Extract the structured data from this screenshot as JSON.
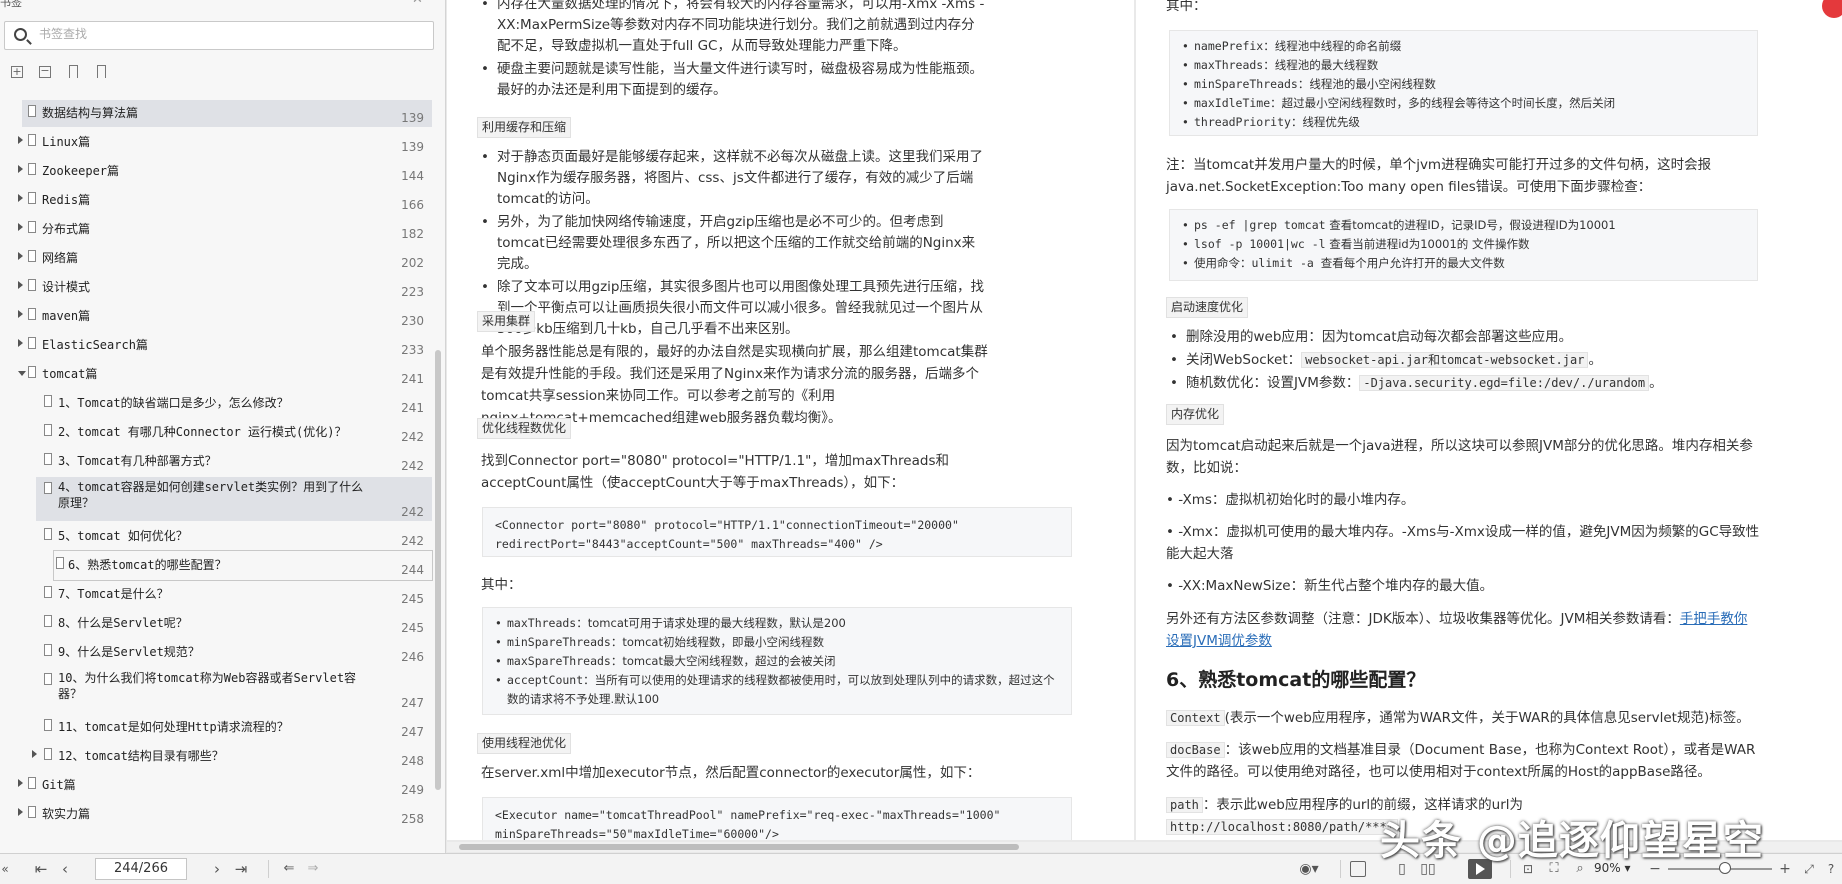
{
  "sidebar": {
    "header_label": "书签",
    "search_placeholder": "书签查找",
    "toc": [
      {
        "title": "数据结构与算法篇",
        "page": "139",
        "level": 0,
        "expander": "none",
        "highlight": true
      },
      {
        "title": "Linux篇",
        "page": "139",
        "level": 0,
        "expander": "collapsed"
      },
      {
        "title": "Zookeeper篇",
        "page": "144",
        "level": 0,
        "expander": "collapsed"
      },
      {
        "title": "Redis篇",
        "page": "166",
        "level": 0,
        "expander": "collapsed"
      },
      {
        "title": "分布式篇",
        "page": "182",
        "level": 0,
        "expander": "collapsed"
      },
      {
        "title": "网络篇",
        "page": "202",
        "level": 0,
        "expander": "collapsed"
      },
      {
        "title": "设计模式",
        "page": "223",
        "level": 0,
        "expander": "collapsed"
      },
      {
        "title": "maven篇",
        "page": "230",
        "level": 0,
        "expander": "collapsed"
      },
      {
        "title": "ElasticSearch篇",
        "page": "233",
        "level": 0,
        "expander": "collapsed"
      },
      {
        "title": "tomcat篇",
        "page": "241",
        "level": 0,
        "expander": "expanded"
      },
      {
        "title": "1、Tomcat的缺省端口是多少，怎么修改？",
        "page": "241",
        "level": 1,
        "expander": "none"
      },
      {
        "title": "2、tomcat 有哪几种Connector 运行模式(优化)？",
        "page": "242",
        "level": 1,
        "expander": "none"
      },
      {
        "title": "3、Tomcat有几种部署方式？",
        "page": "242",
        "level": 1,
        "expander": "none"
      },
      {
        "title": "4、tomcat容器是如何创建servlet类实例？用到了什么原理？",
        "page": "242",
        "level": 1,
        "expander": "none",
        "highlight": true,
        "tall": true
      },
      {
        "title": "5、tomcat 如何优化？",
        "page": "242",
        "level": 1,
        "expander": "none"
      },
      {
        "title": "6、熟悉tomcat的哪些配置？",
        "page": "244",
        "level": 1,
        "expander": "none",
        "current": true
      },
      {
        "title": "7、Tomcat是什么？",
        "page": "245",
        "level": 1,
        "expander": "none"
      },
      {
        "title": "8、什么是Servlet呢？",
        "page": "245",
        "level": 1,
        "expander": "none"
      },
      {
        "title": "9、什么是Servlet规范？",
        "page": "246",
        "level": 1,
        "expander": "none"
      },
      {
        "title": "10、为什么我们将tomcat称为Web容器或者Servlet容器？",
        "page": "247",
        "level": 1,
        "expander": "none",
        "tall": true
      },
      {
        "title": "11、tomcat是如何处理Http请求流程的？",
        "page": "247",
        "level": 1,
        "expander": "none"
      },
      {
        "title": "12、tomcat结构目录有哪些？",
        "page": "248",
        "level": 1,
        "expander": "collapsed"
      },
      {
        "title": "Git篇",
        "page": "249",
        "level": 0,
        "expander": "collapsed"
      },
      {
        "title": "软实力篇",
        "page": "258",
        "level": 0,
        "expander": "collapsed"
      }
    ]
  },
  "left_page": {
    "top_bullets": [
      "内存在大量数据处理的情况下，将会有较大的内存容量需求，可以用-Xmx -Xms -XX:MaxPermSize等参数对内存不同功能块进行划分。我们之前就遇到过内存分配不足，导致虚拟机一直处于full GC，从而导致处理能力严重下降。",
      "硬盘主要问题就是读写性能，当大量文件进行读写时，磁盘极容易成为性能瓶颈。最好的办法还是利用下面提到的缓存。"
    ],
    "tag_cache": "利用缓存和压缩",
    "cache_bullets": [
      "对于静态页面最好是能够缓存起来，这样就不必每次从磁盘上读。这里我们采用了Nginx作为缓存服务器，将图片、css、js文件都进行了缓存，有效的减少了后端tomcat的访问。",
      "另外，为了能加快网络传输速度，开启gzip压缩也是必不可少的。但考虑到tomcat已经需要处理很多东西了，所以把这个压缩的工作就交给前端的Nginx来完成。",
      "除了文本可以用gzip压缩，其实很多图片也可以用图像处理工具预先进行压缩，找到一个平衡点可以让画质损失很小而文件可以减小很多。曾经我就见过一个图片从300多kb压缩到几十kb，自己几乎看不出来区别。"
    ],
    "tag_cluster": "采用集群",
    "cluster_text": "单个服务器性能总是有限的，最好的办法自然是实现横向扩展，那么组建tomcat集群是有效提升性能的手段。我们还是采用了Nginx来作为请求分流的服务器，后端多个tomcat共享session来协同工作。可以参考之前写的《利用nginx+tomcat+memcached组建web服务器负载均衡》。",
    "tag_thread": "优化线程数优化",
    "thread_text": "找到Connector port=\"8080\" protocol=\"HTTP/1.1\"，增加maxThreads和acceptCount属性（使acceptCount大于等于maxThreads），如下：",
    "connector_code": "<Connector port=\"8080\" protocol=\"HTTP/1.1\"connectionTimeout=\"20000\"\nredirectPort=\"8443\"acceptCount=\"500\" maxThreads=\"400\" />",
    "among_label": "其中：",
    "param_list": [
      {
        "name": "maxThreads",
        "desc": "：tomcat可用于请求处理的最大线程数，默认是200"
      },
      {
        "name": "minSpareThreads",
        "desc": "：tomcat初始线程数，即最小空闲线程数"
      },
      {
        "name": "maxSpareThreads",
        "desc": "：tomcat最大空闲线程数，超过的会被关闭"
      },
      {
        "name": "acceptCount",
        "desc": "：当所有可以使用的处理请求的线程数都被使用时，可以放到处理队列中的请求数，超过这个数的请求将不予处理.默认100"
      }
    ],
    "tag_pool": "使用线程池优化",
    "pool_text": "在server.xml中增加executor节点，然后配置connector的executor属性，如下：",
    "executor_code": "<Executor name=\"tomcatThreadPool\" namePrefix=\"req-exec-\"maxThreads=\"1000\"\nminSpareThreads=\"50\"maxIdleTime=\"60000\"/>"
  },
  "right_page": {
    "among_label": "其中：",
    "pool_params": [
      {
        "name": "namePrefix",
        "desc": "：线程池中线程的命名前缀"
      },
      {
        "name": "maxThreads",
        "desc": "：线程池的最大线程数"
      },
      {
        "name": "minSpareThreads",
        "desc": "：线程池的最小空闲线程数"
      },
      {
        "name": "maxIdleTime",
        "desc": "：超过最小空闲线程数时，多的线程会等待这个时间长度，然后关闭"
      },
      {
        "name": "threadPriority",
        "desc": "：线程优先级"
      }
    ],
    "note_text": "注：当tomcat并发用户量大的时候，单个jvm进程确实可能打开过多的文件句柄，这时会报java.net.SocketException:Too many open files错误。可使用下面步骤检查：",
    "check_steps": [
      {
        "name": "ps -ef |grep tomcat",
        "desc": " 查看tomcat的进程ID，记录ID号，假设进程ID为10001"
      },
      {
        "name": "lsof -p 10001|wc -l",
        "desc": " 查看当前进程id为10001的 文件操作数"
      },
      {
        "name": "使用命令：",
        "desc": "ulimit -a 查看每个用户允许打开的最大文件数",
        "desc_mono": true
      }
    ],
    "tag_startup": "启动速度优化",
    "startup_bullets": [
      {
        "pre": "删除没用的web应用：因为tomcat启动每次都会部署这些应用。",
        "code": "",
        "post": ""
      },
      {
        "pre": "关闭WebSocket：",
        "code": "websocket-api.jar和tomcat-websocket.jar",
        "post": "。"
      },
      {
        "pre": "随机数优化：设置JVM参数：",
        "code": "-Djava.security.egd=file:/dev/./urandom",
        "post": "。"
      }
    ],
    "tag_memory": "内存优化",
    "memory_text": "因为tomcat启动起来后就是一个java进程，所以这块可以参照JVM部分的优化思路。堆内存相关参数，比如说：",
    "xms_line": "• -Xms：虚拟机初始化时的最小堆内存。",
    "xmx_line": "• -Xmx：虚拟机可使用的最大堆内存。-Xms与-Xmx设成一样的值，避免JVM因为频繁的GC导致性能大起大落",
    "newsize_line": "• -XX:MaxNewSize：新生代占整个堆内存的最大值。",
    "other_text": "另外还有方法区参数调整（注意：JDK版本）、垃圾收集器等优化。JVM相关参数请看：",
    "other_link": "手把手教你设置JVM调优参数",
    "heading": "6、熟悉tomcat的哪些配置？",
    "context_code": "Context",
    "context_text": "(表示一个web应用程序，通常为WAR文件，关于WAR的具体信息见servlet规范)标签。",
    "docbase_code": "docBase",
    "docbase_text": "：该web应用的文档基准目录（Document Base，也称为Context Root），或者是WAR文件的路径。可以使用绝对路径，也可以使用相对于context所属的Host的appBase路径。",
    "path_code": "path",
    "path_text": "：表示此web应用程序的url的前缀，这样请求的url为",
    "path_url": "http://localhost:8080/path/****",
    "path_end": "。"
  },
  "bottombar": {
    "page_indicator": "244/266",
    "zoom": "90%",
    "first_icon": "first-page-icon",
    "prev_icon": "prev-page-icon",
    "next_icon": "next-page-icon",
    "last_icon": "last-page-icon"
  },
  "watermark": "头条 @追逐仰望星空"
}
